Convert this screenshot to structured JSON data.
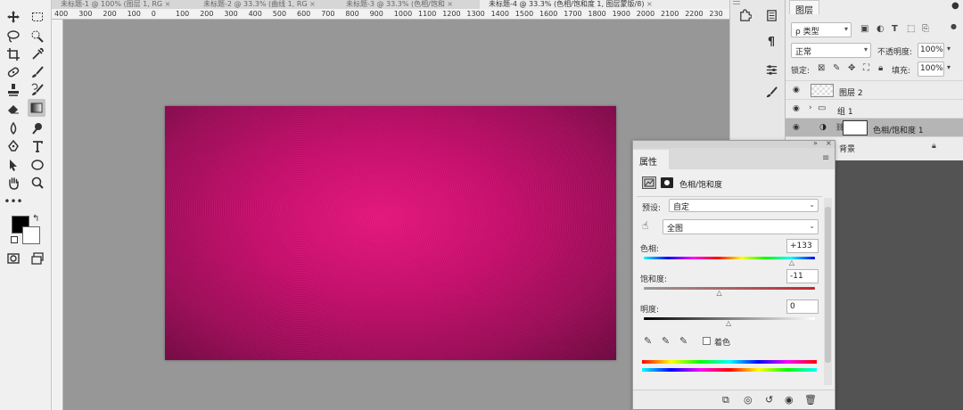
{
  "document_tabs": [
    {
      "label": "未标题-1 @ 100% (图层 1, RG",
      "active": false
    },
    {
      "label": "未标题-2 @ 33.3% (曲线 1, RG",
      "active": false
    },
    {
      "label": "未标题-3 @ 33.3% (色相/饱和",
      "active": false
    },
    {
      "label": "未标题-4 @ 33.3% (色相/饱和度 1, 图层蒙版/8)",
      "active": true
    }
  ],
  "tab_close": "×",
  "ruler_labels": [
    "400",
    "300",
    "200",
    "100",
    "0",
    "100",
    "200",
    "300",
    "400",
    "500",
    "600",
    "700",
    "800",
    "900",
    "1000",
    "1100",
    "1200",
    "1300",
    "1400",
    "1500",
    "1600",
    "1700",
    "1800",
    "1900",
    "2000",
    "2100",
    "2200",
    "230"
  ],
  "layers_panel": {
    "tab_label": "图层",
    "filter_kind": "ρ 类型",
    "blend_mode": "正常",
    "opacity_label": "不透明度:",
    "opacity_value": "100%",
    "lock_label": "锁定:",
    "fill_label": "填充:",
    "fill_value": "100%",
    "layers": [
      {
        "name": "图层 2",
        "type": "pixel",
        "selected": false
      },
      {
        "name": "组 1",
        "type": "group",
        "selected": false
      },
      {
        "name": "色相/饱和度 1",
        "type": "adjustment",
        "selected": true
      },
      {
        "name": "背景",
        "type": "background",
        "selected": false
      }
    ]
  },
  "properties_panel": {
    "tab_label": "属性",
    "adjustment_title": "色相/饱和度",
    "preset_label": "预设:",
    "preset_value": "自定",
    "channel_value": "全图",
    "hue_label": "色相:",
    "hue_value": "+133",
    "hue_range": [
      -180,
      180
    ],
    "saturation_label": "饱和度:",
    "saturation_value": "-11",
    "saturation_range": [
      -100,
      100
    ],
    "lightness_label": "明度:",
    "lightness_value": "0",
    "lightness_range": [
      -100,
      100
    ],
    "colorize_label": "着色",
    "colorize_checked": false
  },
  "colors": {
    "accent": "#e8157e",
    "canvas_background": "#979797",
    "panel_background": "#efefef"
  }
}
